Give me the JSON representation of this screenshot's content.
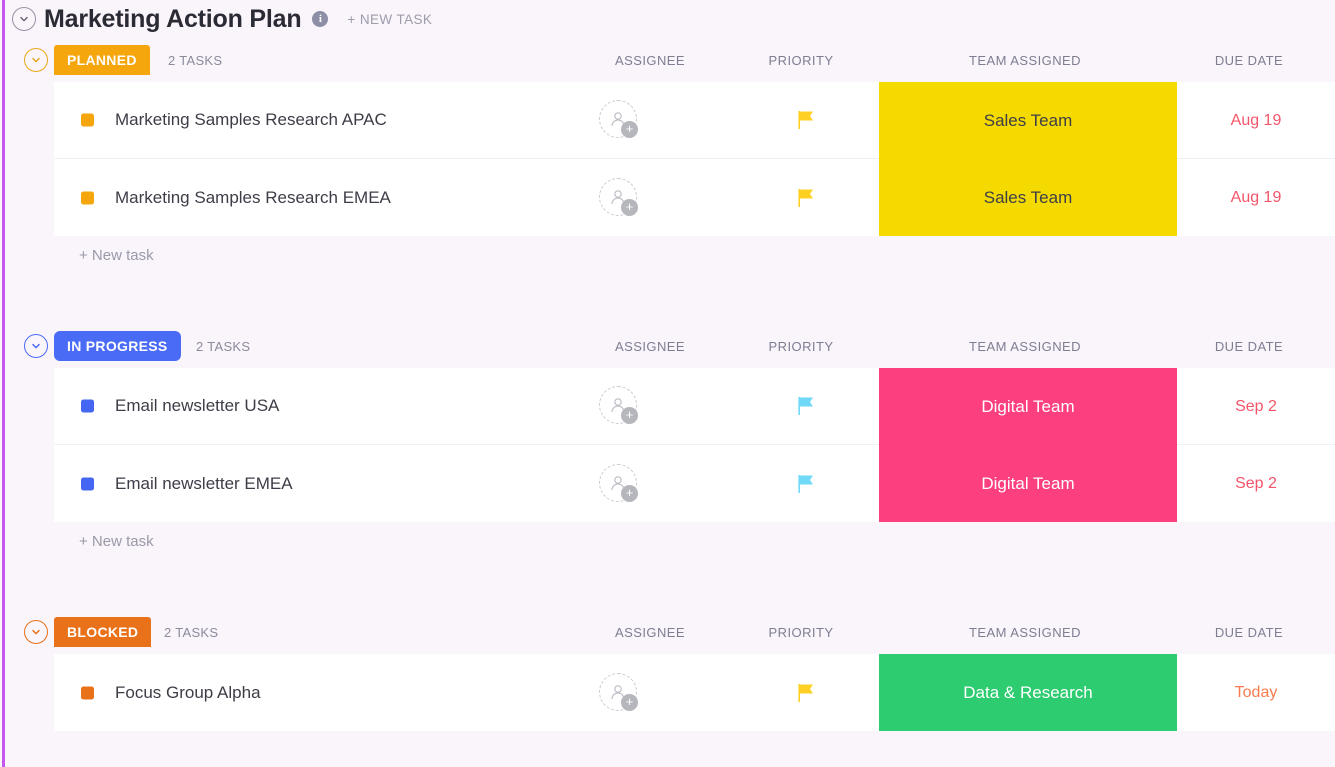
{
  "header": {
    "title": "Marketing Action Plan",
    "info_icon": "info-icon",
    "new_task_label": "+ NEW TASK"
  },
  "columns": {
    "assignee": "ASSIGNEE",
    "priority": "PRIORITY",
    "team_assigned": "TEAM ASSIGNED",
    "due_date": "DUE DATE"
  },
  "new_task_row_label": "+ New task",
  "colors": {
    "accent_stripe": "#C457F0",
    "planned": "#F5A60C",
    "in_progress": "#4A6BF5",
    "blocked": "#E8711A",
    "sales_team_bg": "#F5DA00",
    "digital_team_bg": "#FC3F7F",
    "data_research_bg": "#2ECC71",
    "due_overdue": "#F4556A",
    "due_today": "#F97B4F",
    "page_bg": "#FAF4FB"
  },
  "groups": [
    {
      "id": "planned",
      "status": "PLANNED",
      "count_label": "2 TASKS",
      "accent": "#F5A60C",
      "tasks": [
        {
          "name": "Marketing Samples Research APAC",
          "dot_color": "#F5A60C",
          "assignee": "",
          "priority_flag_color": "#FFD024",
          "team": "Sales Team",
          "team_bg": "#F5DA00",
          "team_text_color": "#3d3d48",
          "due": "Aug 19",
          "due_color": "#F4556A"
        },
        {
          "name": "Marketing Samples Research EMEA",
          "dot_color": "#F5A60C",
          "assignee": "",
          "priority_flag_color": "#FFD024",
          "team": "Sales Team",
          "team_bg": "#F5DA00",
          "team_text_color": "#3d3d48",
          "due": "Aug 19",
          "due_color": "#F4556A"
        }
      ]
    },
    {
      "id": "in-progress",
      "status": "IN PROGRESS",
      "count_label": "2 TASKS",
      "accent": "#4A6BF5",
      "tasks": [
        {
          "name": "Email newsletter USA",
          "dot_color": "#4466F2",
          "assignee": "",
          "priority_flag_color": "#6FD9F7",
          "team": "Digital Team",
          "team_bg": "#FC3F7F",
          "team_text_color": "#ffffff",
          "due": "Sep 2",
          "due_color": "#F4556A"
        },
        {
          "name": "Email newsletter EMEA",
          "dot_color": "#4466F2",
          "assignee": "",
          "priority_flag_color": "#6FD9F7",
          "team": "Digital Team",
          "team_bg": "#FC3F7F",
          "team_text_color": "#ffffff",
          "due": "Sep 2",
          "due_color": "#F4556A"
        }
      ]
    },
    {
      "id": "blocked",
      "status": "BLOCKED",
      "count_label": "2 TASKS",
      "accent": "#E8711A",
      "tasks": [
        {
          "name": "Focus Group Alpha",
          "dot_color": "#E8711A",
          "assignee": "",
          "priority_flag_color": "#FFD024",
          "team": "Data & Research",
          "team_bg": "#2ECC71",
          "team_text_color": "#ffffff",
          "due": "Today",
          "due_color": "#F97B4F"
        }
      ]
    }
  ]
}
